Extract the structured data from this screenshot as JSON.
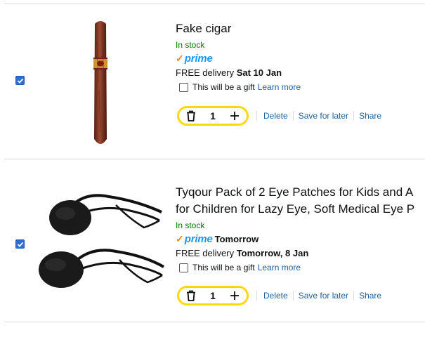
{
  "items": [
    {
      "title_lines": [
        "Fake cigar"
      ],
      "stock": "In stock",
      "prime_label": "prime",
      "prime_extra": "",
      "delivery_prefix": "FREE delivery ",
      "delivery_date": "Sat 10 Jan",
      "gift_text": "This will be a gift",
      "learn_more": "Learn more",
      "quantity": "1",
      "delete": "Delete",
      "save_for_later": "Save for later",
      "share": "Share"
    },
    {
      "title_lines": [
        "Tyqour Pack of 2 Eye Patches for Kids and A",
        "for Children for Lazy Eye, Soft Medical Eye P"
      ],
      "stock": "In stock",
      "prime_label": "prime",
      "prime_extra": "Tomorrow",
      "delivery_prefix": "FREE delivery ",
      "delivery_date": "Tomorrow, 8 Jan",
      "gift_text": "This will be a gift",
      "learn_more": "Learn more",
      "quantity": "1",
      "delete": "Delete",
      "save_for_later": "Save for later",
      "share": "Share"
    }
  ],
  "colors": {
    "link": "#2162a1",
    "stock": "#007600",
    "prime_blue": "#1a98ff",
    "prime_check": "#f08804",
    "qty_border": "#ffd814",
    "checkbox": "#2a6fd1"
  }
}
